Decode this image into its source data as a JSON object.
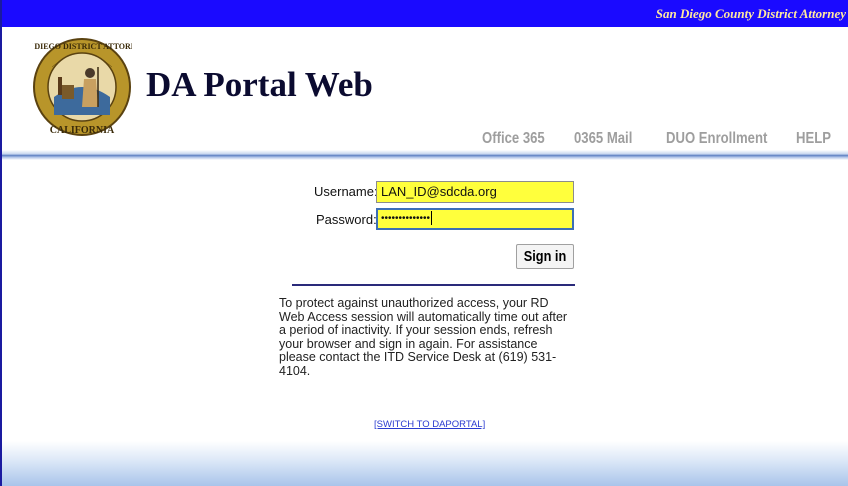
{
  "topbar": {
    "agency": "San Diego County District Attorney"
  },
  "header": {
    "title": "DA Portal Web",
    "seal": {
      "top_text": "SAN DIEGO DISTRICT ATTORNEY",
      "bottom_text": "CALIFORNIA"
    }
  },
  "nav": {
    "items": [
      {
        "label": "Office 365"
      },
      {
        "label": "0365 Mail"
      },
      {
        "label": "DUO Enrollment"
      },
      {
        "label": "HELP"
      }
    ]
  },
  "login": {
    "username_label": "Username:",
    "username_value": "LAN_ID@sdcda.org",
    "password_label": "Password:",
    "password_masked": "••••••••••••••",
    "signin_label": "Sign in"
  },
  "notice": "To protect against unauthorized access, your RD Web Access session will automatically time out after a period of inactivity. If your session ends, refresh your browser and sign in again. For assistance please contact the ITD Service Desk at (619) 531-4104.",
  "switch_link": "[SWITCH TO DAPORTAL]",
  "colors": {
    "topbar": "#1a0aff",
    "topbar_text": "#ffe8a0",
    "input_highlight": "#ffff3c",
    "nav_text": "#9e9e9e"
  }
}
